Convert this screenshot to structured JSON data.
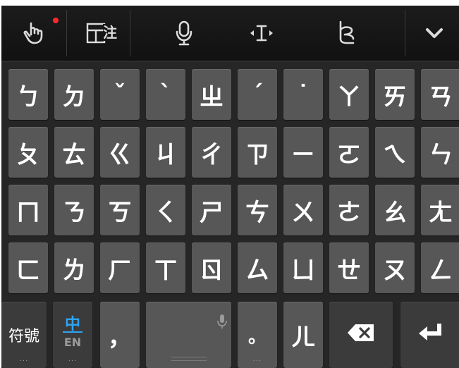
{
  "colors": {
    "keyboard_bg": "#262626",
    "key_bg": "#575757",
    "key_dark_bg": "#3b3b3b",
    "accent": "#2fa4f5",
    "notification": "#ff2a2a"
  },
  "toolbar": {
    "icons": [
      "hand-pointer-icon",
      "zhuyin-layout-icon",
      "microphone-icon",
      "text-cursor-icon",
      "handwriting-icon",
      "chevron-down-icon"
    ],
    "layout_label": "注"
  },
  "rows": [
    [
      "ㄅ",
      "ㄉ",
      "ˇ",
      "ˋ",
      "ㄓ",
      "ˊ",
      "˙",
      "ㄚ",
      "ㄞ",
      "ㄢ"
    ],
    [
      "ㄆ",
      "ㄊ",
      "ㄍ",
      "ㄐ",
      "ㄔ",
      "ㄗ",
      "ㄧ",
      "ㄛ",
      "ㄟ",
      "ㄣ"
    ],
    [
      "ㄇ",
      "ㄋ",
      "ㄎ",
      "ㄑ",
      "ㄕ",
      "ㄘ",
      "ㄨ",
      "ㄜ",
      "ㄠ",
      "ㄤ"
    ],
    [
      "ㄈ",
      "ㄌ",
      "ㄏ",
      "ㄒ",
      "ㄖ",
      "ㄙ",
      "ㄩ",
      "ㄝ",
      "ㄡ",
      "ㄥ"
    ]
  ],
  "bottom": {
    "symbols_label": "符號",
    "mode_zh": "中",
    "mode_en": "EN",
    "comma": "，",
    "period": "。",
    "er": "ㄦ",
    "more_dots": "···"
  }
}
